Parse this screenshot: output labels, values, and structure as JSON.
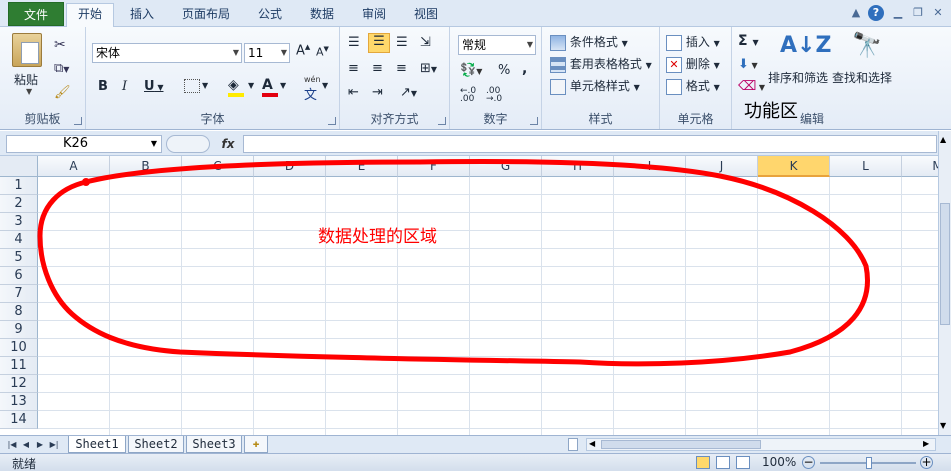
{
  "tabs": [
    "文件",
    "开始",
    "插入",
    "页面布局",
    "公式",
    "数据",
    "审阅",
    "视图"
  ],
  "ribbon": {
    "clipboard": {
      "paste": "粘贴",
      "label": "剪贴板"
    },
    "font": {
      "name": "宋体",
      "size": "11",
      "bold": "B",
      "italic": "I",
      "underline": "U",
      "font_color": "A",
      "phonetic": "wén",
      "label": "字体"
    },
    "alignment": {
      "label": "对齐方式"
    },
    "number": {
      "format": "常规",
      "percent": "%",
      "comma": ",",
      "label": "数字"
    },
    "styles": {
      "conditional": "条件格式",
      "table": "套用表格格式",
      "cell": "单元格样式",
      "label": "样式"
    },
    "cells": {
      "insert": "插入",
      "delete": "删除",
      "format": "格式",
      "label": "单元格"
    },
    "editing": {
      "sigma": "Σ",
      "sort": "排序和筛选",
      "find": "查找和选择",
      "label": "编辑"
    }
  },
  "annotation_ribbon": "功能区",
  "annotation_grid": "数据处理的区域",
  "formula_bar": {
    "name_box": "K26",
    "fx": "fx",
    "content": ""
  },
  "columns": [
    "A",
    "B",
    "C",
    "D",
    "E",
    "F",
    "G",
    "H",
    "I",
    "J",
    "K",
    "L",
    "M"
  ],
  "selected_column": "K",
  "rows": [
    "1",
    "2",
    "3",
    "4",
    "5",
    "6",
    "7",
    "8",
    "9",
    "10",
    "11",
    "12",
    "13",
    "14"
  ],
  "sheets": [
    "Sheet1",
    "Sheet2",
    "Sheet3"
  ],
  "active_sheet": "Sheet1",
  "status": {
    "ready": "就绪",
    "zoom": "100%"
  },
  "colors": {
    "accent_file": "#2f7d32",
    "annotation_red": "#ff0000",
    "selected_header": "#ffd66d"
  }
}
